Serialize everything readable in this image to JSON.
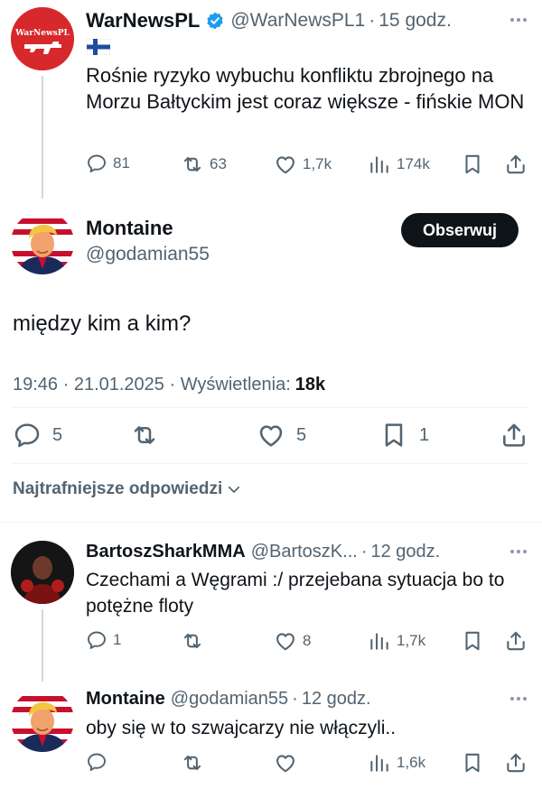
{
  "colors": {
    "text": "#0f1419",
    "muted": "#536471",
    "verified": "#1d9bf0",
    "button_bg": "#0f1419"
  },
  "post1": {
    "display_name": "WarNewsPL",
    "handle": "@WarNewsPL1",
    "time": "15 godz.",
    "avatar_label": "WarNewsPL",
    "flag_icon": "finland-flag-icon",
    "text": "Rośnie ryzyko wybuchu konfliktu zbrojnego na Morzu Bałtyckim jest coraz większe - fińskie MON",
    "replies": "81",
    "reposts": "63",
    "likes": "1,7k",
    "views": "174k"
  },
  "main": {
    "display_name": "Montaine",
    "handle": "@godamian55",
    "follow_label": "Obserwuj",
    "text": "między kim a kim?",
    "timestamp": "19:46 · 21.01.2025 · Wyświetlenia:",
    "views": "18k",
    "replies": "5",
    "likes": "5",
    "bookmarks": "1"
  },
  "sort_label": "Najtrafniejsze odpowiedzi",
  "reply1": {
    "display_name": "BartoszSharkMMA",
    "handle": "@BartoszK...",
    "time": "12 godz.",
    "text": "Czechami a Węgrami :/ przejebana sytuacja bo to potężne floty",
    "replies": "1",
    "likes": "8",
    "views": "1,7k"
  },
  "reply2": {
    "display_name": "Montaine",
    "handle": "@godamian55",
    "time": "12 godz.",
    "text": "oby się w to szwajcarzy nie włączyli..",
    "views": "1,6k"
  }
}
